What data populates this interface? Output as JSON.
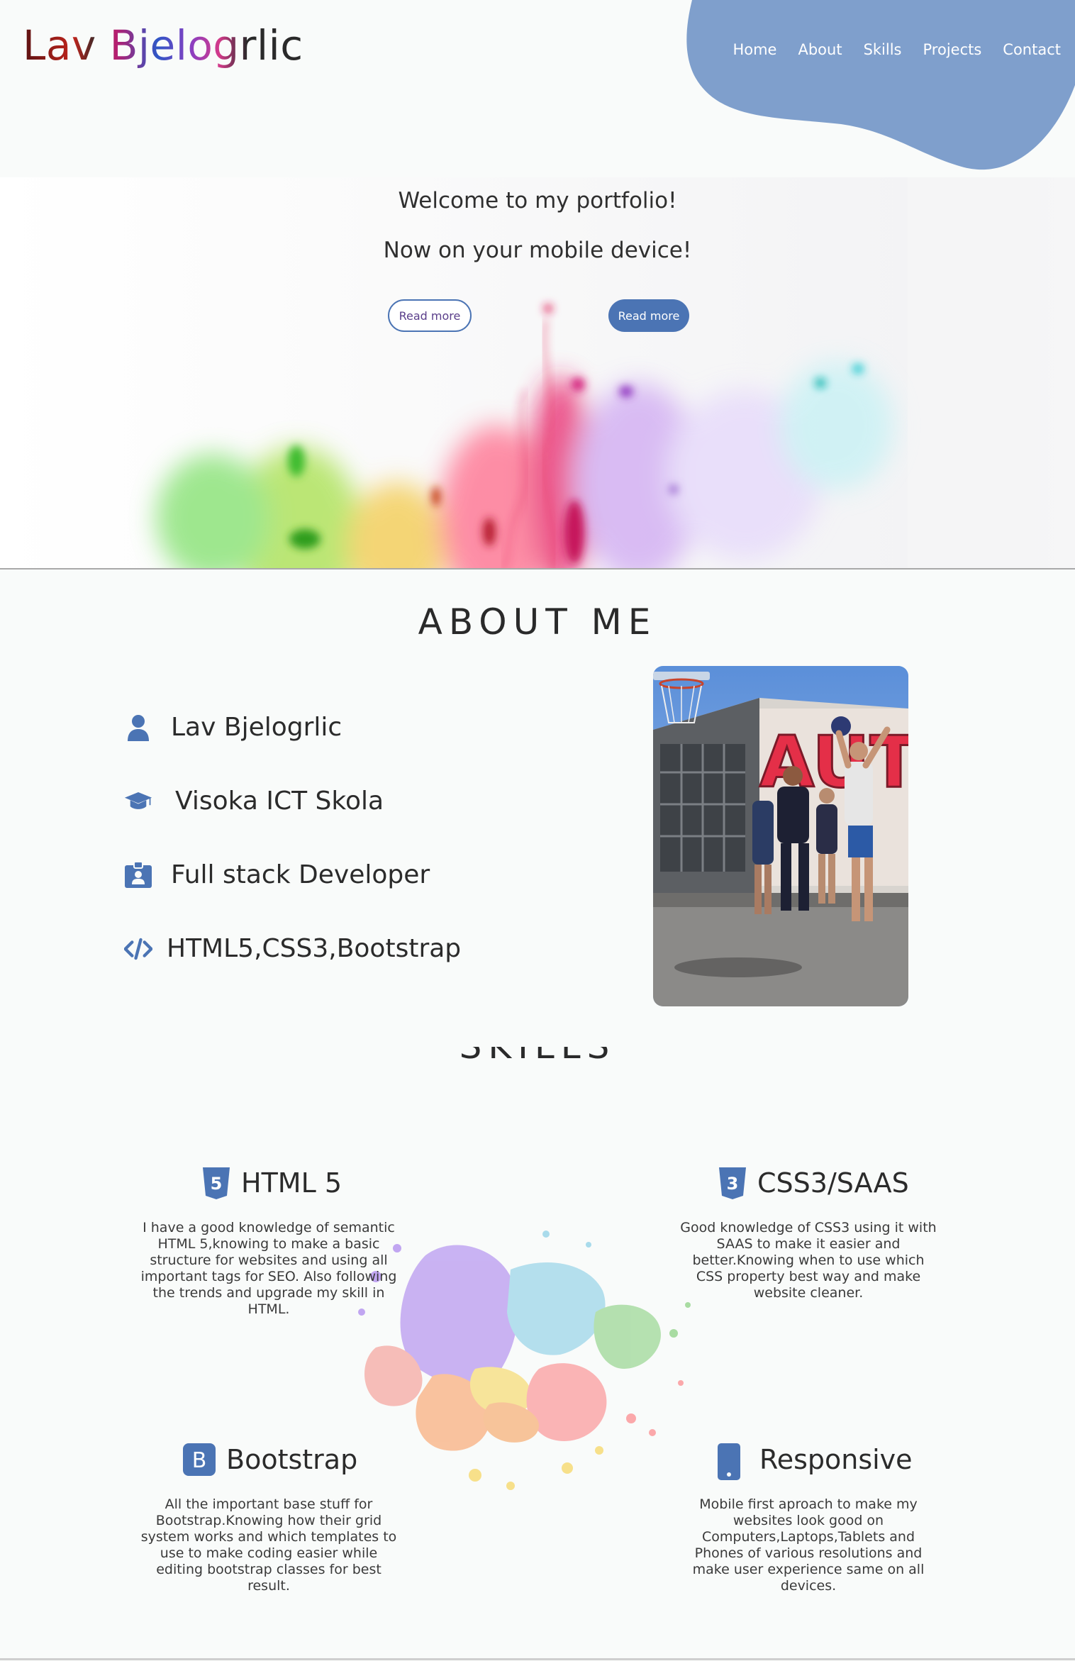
{
  "header": {
    "logo": "Lav Bjelogrlic",
    "nav": [
      "Home",
      "About",
      "Skills",
      "Projects",
      "Contact"
    ],
    "blob_color": "#7f9fcc"
  },
  "hero": {
    "title": "Welcome to my portfolio!",
    "subtitle": "Now on your mobile device!",
    "btn_outline": "Read more",
    "btn_fill": "Read more"
  },
  "about": {
    "title": "ABOUT ME",
    "items": [
      {
        "icon": "user-icon",
        "text": "Lav Bjelogrlic"
      },
      {
        "icon": "graduation-cap-icon",
        "text": "Visoka ICT Skola"
      },
      {
        "icon": "id-badge-icon",
        "text": "Full stack Developer"
      },
      {
        "icon": "code-icon",
        "text": "HTML5,CSS3,Bootstrap"
      }
    ]
  },
  "skills": {
    "title": "SKILLS",
    "items": [
      {
        "icon": "html5-icon",
        "title": "HTML 5",
        "text": "I have a good knowledge of semantic HTML 5,knowing to make a basic structure for websites and using all important tags for SEO. Also following the trends and upgrade my skill in HTML."
      },
      {
        "icon": "css3-icon",
        "title": "CSS3/SAAS",
        "text": "Good knowledge of CSS3 using it with SAAS to make it easier and better.Knowing when to use which CSS property best way and make website cleaner."
      },
      {
        "icon": "bootstrap-icon",
        "title": "Bootstrap",
        "text": "All the important base stuff for Bootstrap.Knowing how their grid system works and which templates to use to make coding easier while editing bootstrap classes for best result."
      },
      {
        "icon": "mobile-icon",
        "title": "Responsive",
        "text": "Mobile first aproach to make my websites look good on Computers,Laptops,Tablets and Phones of various resolutions and make user experience same on all devices."
      }
    ]
  },
  "colors": {
    "accent": "#4b74b4",
    "blob": "#7f9fcc"
  }
}
